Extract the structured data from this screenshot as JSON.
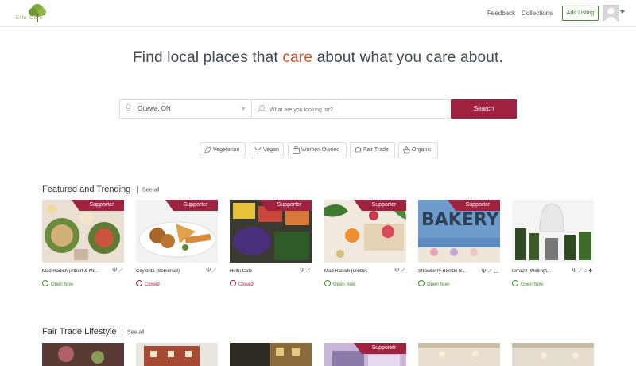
{
  "header": {
    "logo_text": "Ethi Cure",
    "nav": [
      "Feedback",
      "Collections"
    ],
    "add_listing": "Add Listing"
  },
  "hero": {
    "pre": "Find local places that ",
    "accent": "care",
    "post": " about what you care about."
  },
  "search": {
    "location": "Ottawa, ON",
    "placeholder": "What are you looking for?",
    "button": "Search"
  },
  "filters": [
    "Vegetarian",
    "Vegan",
    "Women Owned",
    "Fair Trade",
    "Organic"
  ],
  "sections": [
    {
      "title": "Featured and Trending",
      "see_all": "See all",
      "cards": [
        {
          "name": "Mad Radish (Albert & Me...",
          "supporter": "Supporter",
          "status": "Open Now",
          "open": true,
          "icons": [
            "vegan-icon",
            "leaf-icon"
          ]
        },
        {
          "name": "Ceylonta (Somerset)",
          "supporter": "Supporter",
          "status": "Closed",
          "open": false,
          "icons": [
            "vegan-icon",
            "leaf-icon"
          ]
        },
        {
          "name": "Hintu Cafe",
          "supporter": "Supporter",
          "status": "Closed",
          "open": false,
          "icons": [
            "vegan-icon",
            "leaf-icon"
          ]
        },
        {
          "name": "Mad Radish (Glebe)",
          "supporter": "Supporter",
          "status": "Open Now",
          "open": true,
          "icons": [
            "vegan-icon",
            "leaf-icon"
          ]
        },
        {
          "name": "Strawberry Blonde B...",
          "supporter": "Supporter",
          "status": "Open Now",
          "open": true,
          "icons": [
            "vegan-icon",
            "leaf-icon",
            "briefcase-icon"
          ]
        },
        {
          "name": "terra20 (Wellingt...",
          "supporter": "",
          "status": "Open Now",
          "open": true,
          "icons": [
            "vegan-icon",
            "leaf-icon",
            "basket-icon",
            "tree-icon"
          ]
        }
      ]
    },
    {
      "title": "Fair Trade Lifestyle",
      "see_all": "See all",
      "cards": [
        {
          "supporter": ""
        },
        {
          "supporter": ""
        },
        {
          "supporter": ""
        },
        {
          "supporter": "Supporter"
        },
        {
          "supporter": ""
        },
        {
          "supporter": ""
        }
      ]
    }
  ],
  "colors": {
    "accent": "#a0203f",
    "open": "#3e8f25",
    "hero_accent": "#c8552c"
  }
}
